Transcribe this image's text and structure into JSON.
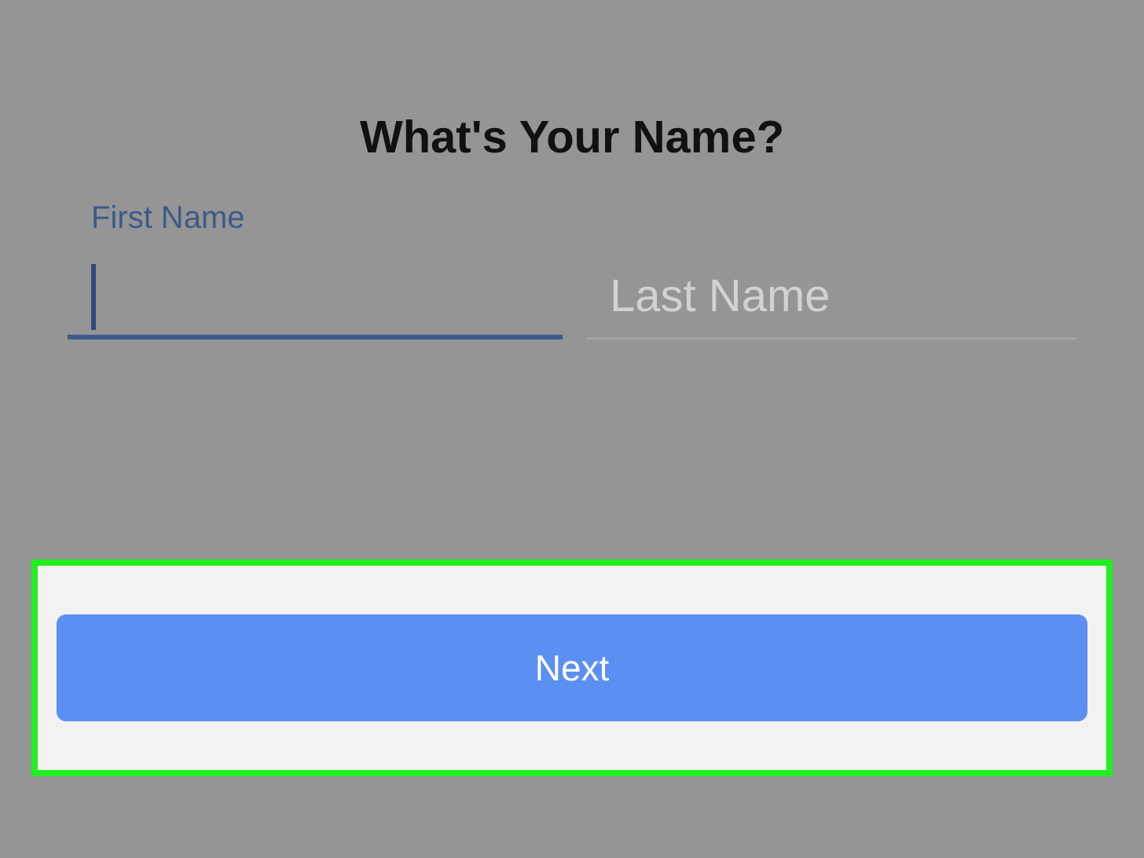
{
  "title": "What's Your Name?",
  "fields": [
    {
      "label": "First Name",
      "focused": true
    },
    {
      "placeholder": "Last Name",
      "focused": false
    }
  ],
  "button": {
    "label": "Next"
  },
  "highlight": {
    "on": true
  }
}
